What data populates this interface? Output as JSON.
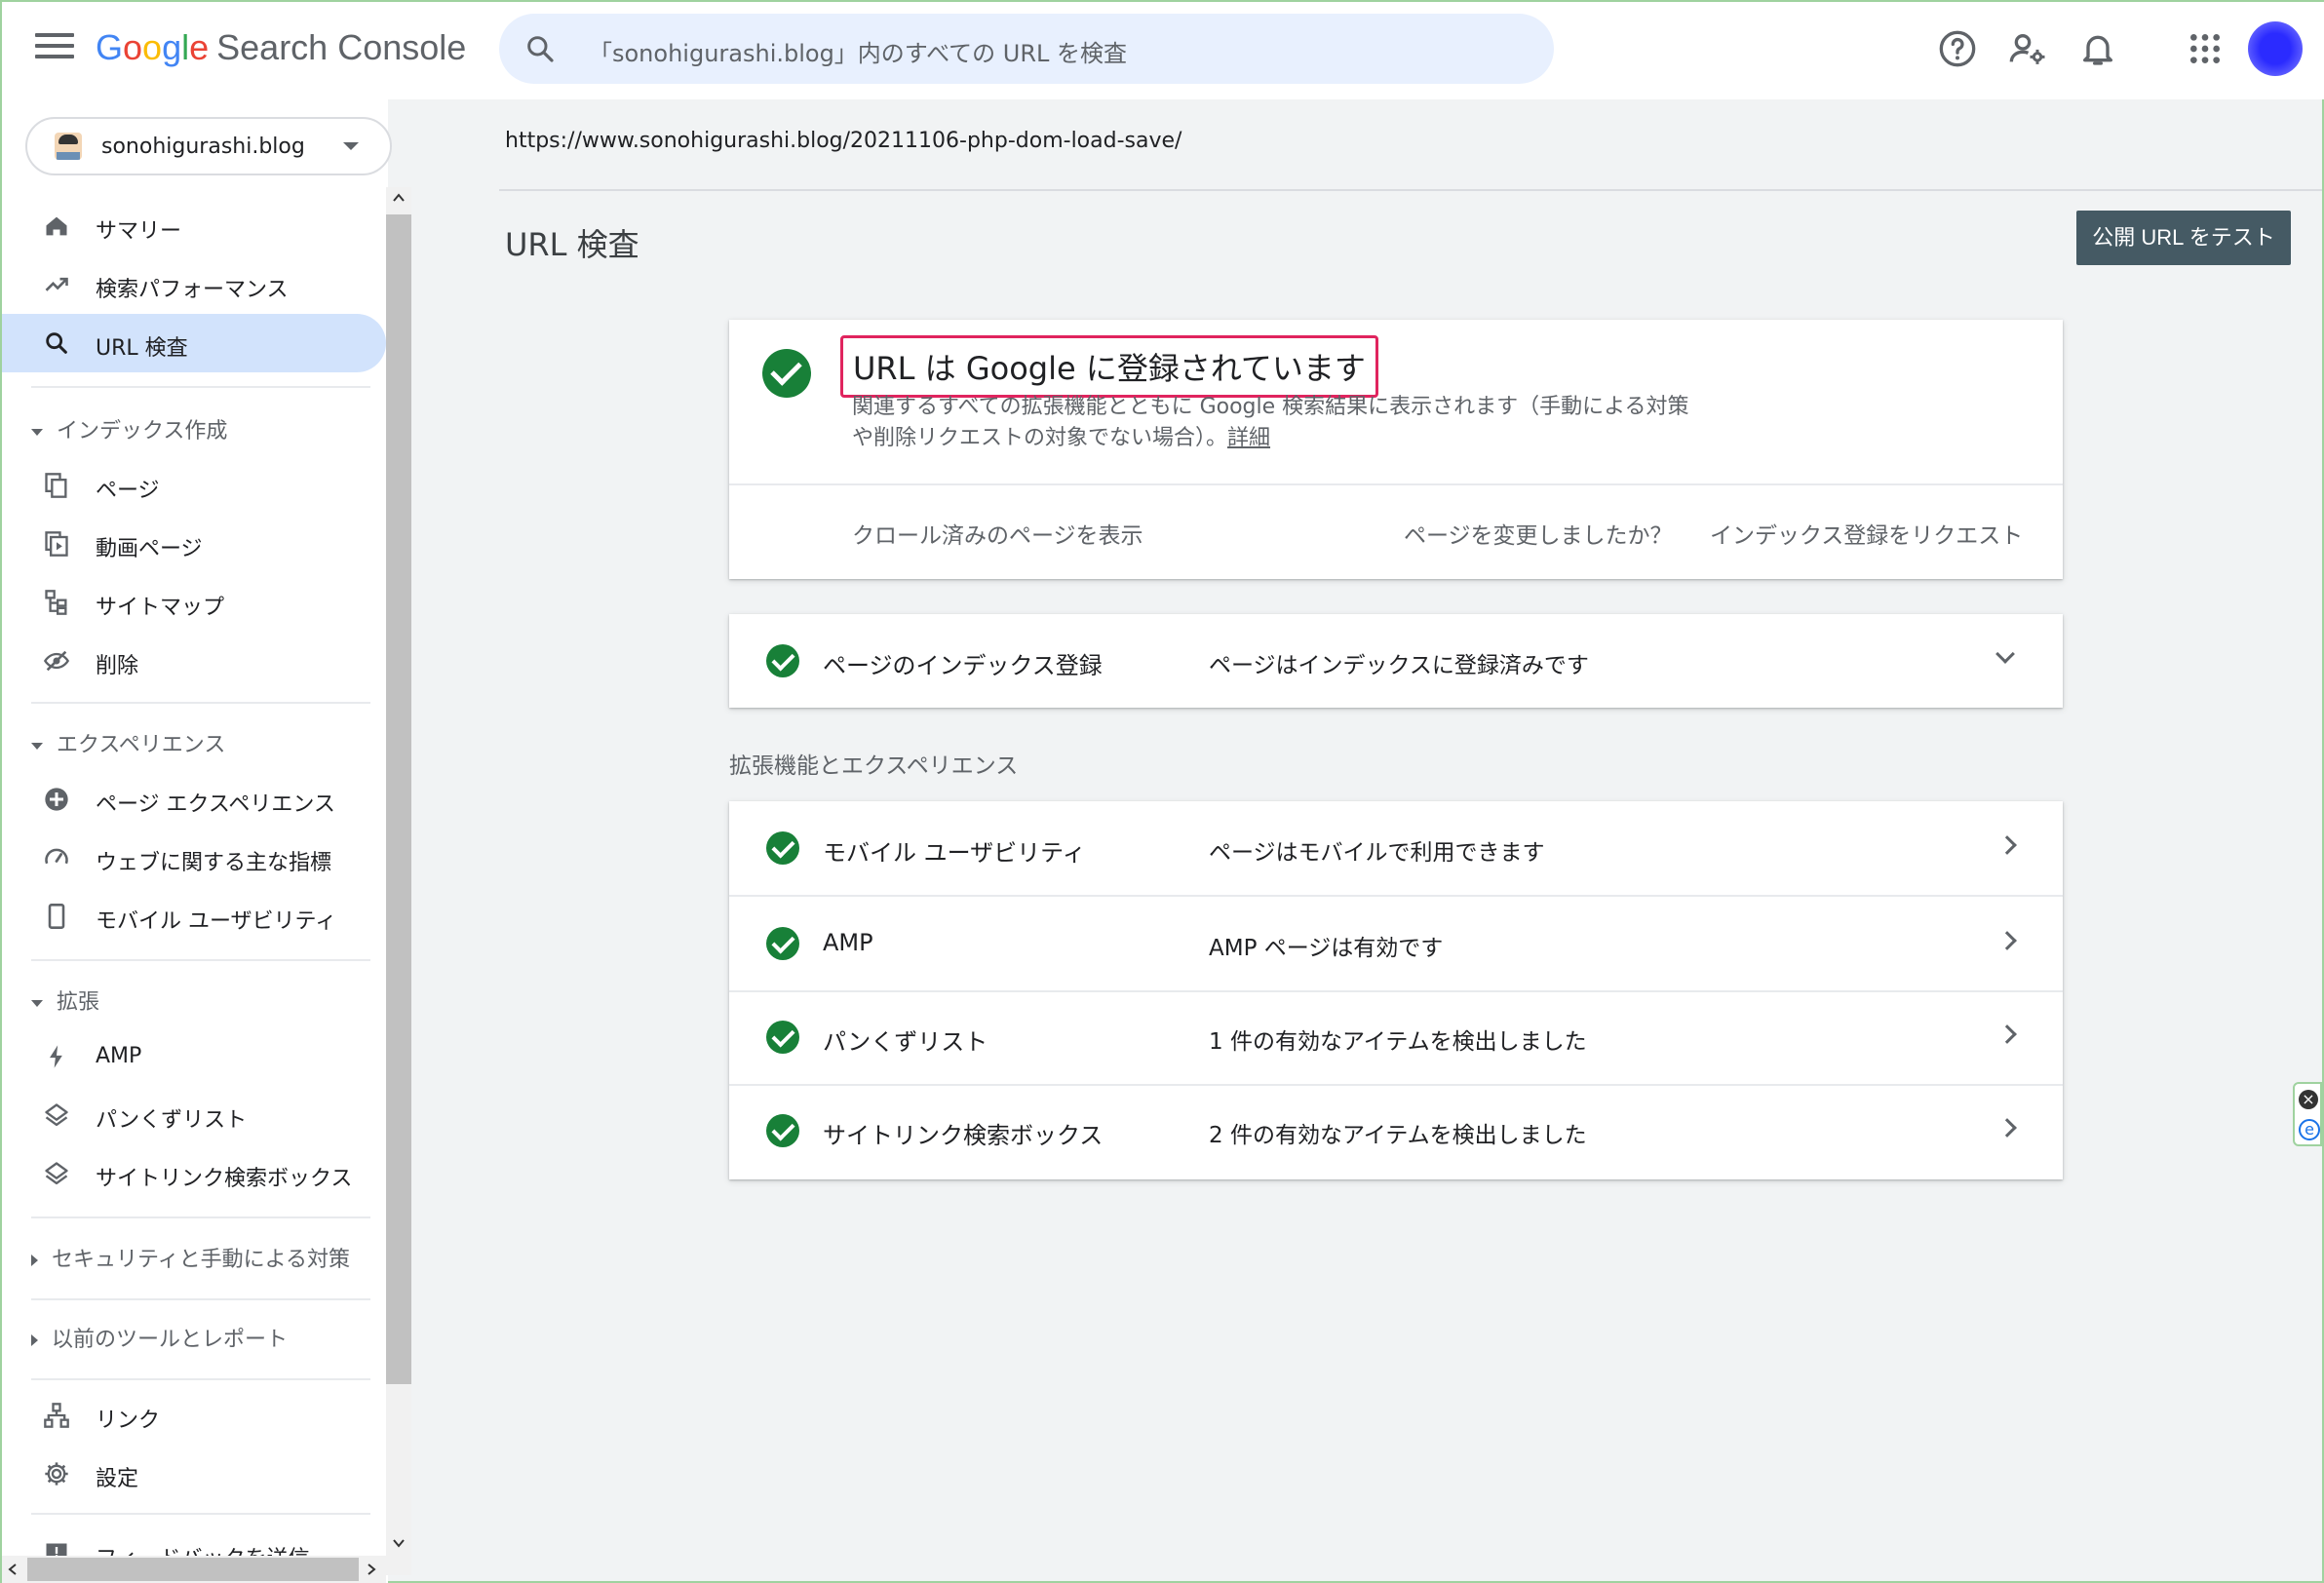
{
  "header": {
    "logo_google": [
      "G",
      "o",
      "o",
      "g",
      "l",
      "e"
    ],
    "product": "Search Console",
    "search_placeholder": "「sonohigurashi.blog」内のすべての URL を検査"
  },
  "property": {
    "name": "sonohigurashi.blog"
  },
  "sidebar": {
    "items": [
      {
        "label": "サマリー",
        "icon": "home-icon"
      },
      {
        "label": "検索パフォーマンス",
        "icon": "trending-up-icon"
      },
      {
        "label": "URL 検査",
        "icon": "search-icon",
        "active": true
      }
    ],
    "sections": {
      "index": "インデックス作成",
      "experience": "エクスペリエンス",
      "enhancements": "拡張",
      "security": "セキュリティと手動による対策",
      "legacy": "以前のツールとレポート"
    },
    "index_items": [
      {
        "label": "ページ",
        "icon": "pages-icon"
      },
      {
        "label": "動画ページ",
        "icon": "video-page-icon"
      },
      {
        "label": "サイトマップ",
        "icon": "sitemap-icon"
      },
      {
        "label": "削除",
        "icon": "removals-icon"
      }
    ],
    "experience_items": [
      {
        "label": "ページ エクスペリエンス",
        "icon": "page-experience-icon"
      },
      {
        "label": "ウェブに関する主な指標",
        "icon": "speed-gauge-icon"
      },
      {
        "label": "モバイル ユーザビリティ",
        "icon": "mobile-icon"
      }
    ],
    "enhancement_items": [
      {
        "label": "AMP",
        "icon": "bolt-icon"
      },
      {
        "label": "パンくずリスト",
        "icon": "layers-icon"
      },
      {
        "label": "サイトリンク検索ボックス",
        "icon": "layers-icon"
      }
    ],
    "bottom_items": [
      {
        "label": "リンク",
        "icon": "links-icon"
      },
      {
        "label": "設定",
        "icon": "settings-icon"
      },
      {
        "label": "フィードバックを送信",
        "icon": "feedback-icon"
      }
    ]
  },
  "main": {
    "inspected_url": "https://www.sonohigurashi.blog/20211106-php-dom-load-save/",
    "title": "URL 検査",
    "test_button": "公開 URL をテスト",
    "status": {
      "title": "URL は Google に登録されています",
      "description": "関連するすべての拡張機能とともに Google 検索結果に表示されます（手動による対策や削除リクエストの対象でない場合）。",
      "details_link": "詳細",
      "view_crawled": "クロール済みのページを表示",
      "changed_question": "ページを変更しましたか？",
      "request_indexing": "インデックス登録をリクエスト"
    },
    "indexing": {
      "label": "ページのインデックス登録",
      "value": "ページはインデックスに登録済みです"
    },
    "enhancements_heading": "拡張機能とエクスペリエンス",
    "enhancements": [
      {
        "label": "モバイル ユーザビリティ",
        "value": "ページはモバイルで利用できます"
      },
      {
        "label": "AMP",
        "value": "AMP ページは有効です"
      },
      {
        "label": "パンくずリスト",
        "value": "1 件の有効なアイテムを検出しました"
      },
      {
        "label": "サイトリンク検索ボックス",
        "value": "2 件の有効なアイテムを検出しました"
      }
    ]
  },
  "colors": {
    "accent_green": "#188038",
    "active_nav": "#d2e3fc",
    "highlight_border": "#e0245e",
    "test_button": "#455a64"
  }
}
